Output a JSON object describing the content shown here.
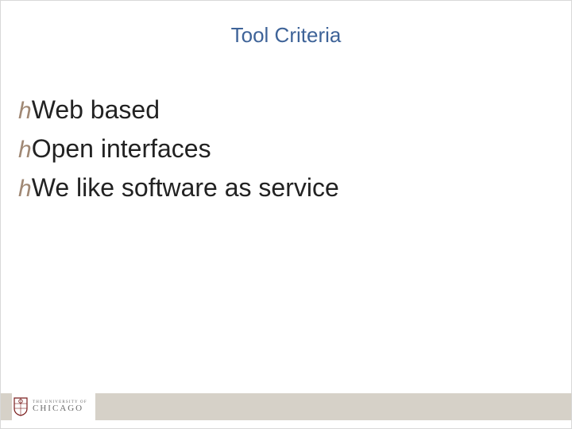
{
  "title": "Tool Criteria",
  "bullets": [
    "Web based",
    "Open interfaces",
    "We like software as service"
  ],
  "bullet_glyph": "h",
  "footer": {
    "logo_line1": "THE UNIVERSITY OF",
    "logo_line2": "CHICAGO"
  }
}
